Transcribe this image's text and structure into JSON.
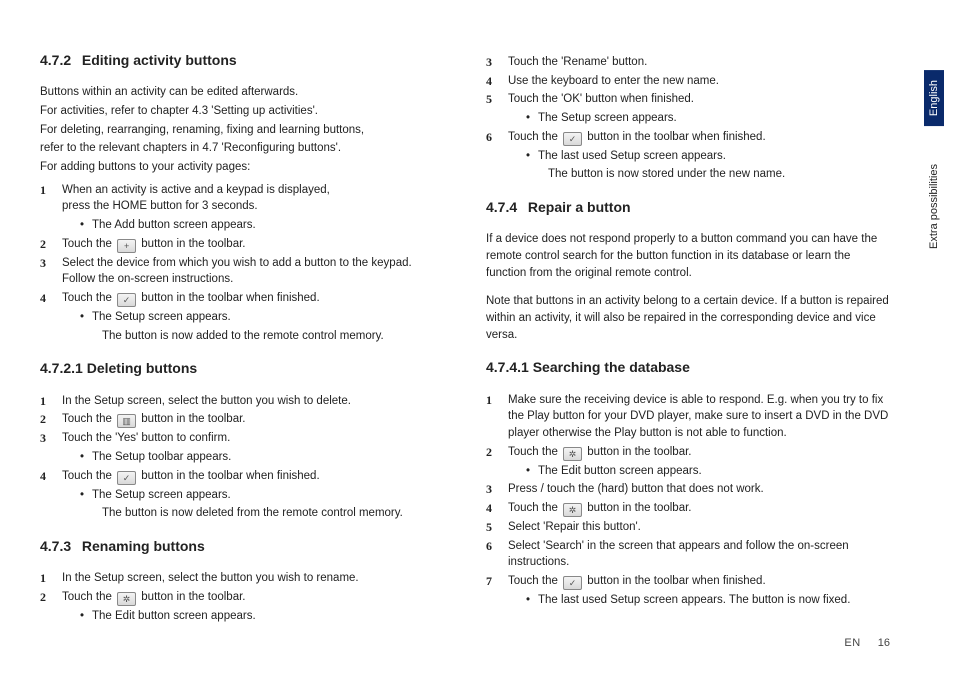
{
  "sideTabs": {
    "active": "English",
    "secondary": "Extra possibilities"
  },
  "footer": {
    "lang": "EN",
    "page": "16"
  },
  "left": {
    "s472": {
      "num": "4.7.2",
      "title": "Editing activity buttons",
      "intro": [
        "Buttons within an activity can be edited afterwards.",
        "For activities, refer to chapter 4.3 'Setting up activities'.",
        "For deleting, rearranging, renaming, fixing and learning buttons,",
        "refer to the relevant chapters in 4.7 'Reconfiguring buttons'.",
        "For adding buttons to your activity pages:"
      ],
      "steps": [
        {
          "n": "1",
          "t": "When an activity is active and a keypad is displayed,",
          "t2": "press the HOME button for 3 seconds.",
          "sub": [
            "The Add button screen appears."
          ]
        },
        {
          "n": "2",
          "pre": "Touch the ",
          "icon": "plus-icon",
          "iconGlyph": "+",
          "post": " button in the toolbar."
        },
        {
          "n": "3",
          "t": "Select the device from which you wish to add a button to the keypad.",
          "t2": "Follow the on-screen instructions."
        },
        {
          "n": "4",
          "pre": "Touch the ",
          "icon": "check-icon",
          "iconGlyph": "✓",
          "post": " button in the toolbar when finished.",
          "sub": [
            "The Setup screen appears."
          ],
          "cont": "The button is now added to the remote control memory."
        }
      ]
    },
    "s4721": {
      "num": "4.7.2.1",
      "title": "Deleting buttons",
      "steps": [
        {
          "n": "1",
          "t": "In the Setup screen, select the button you wish to delete."
        },
        {
          "n": "2",
          "pre": "Touch the ",
          "icon": "trash-icon",
          "iconGlyph": "▥",
          "post": " button in the toolbar."
        },
        {
          "n": "3",
          "t": "Touch the 'Yes' button to confirm.",
          "sub": [
            "The Setup toolbar appears."
          ]
        },
        {
          "n": "4",
          "pre": "Touch the ",
          "icon": "check-icon",
          "iconGlyph": "✓",
          "post": " button in the toolbar when finished.",
          "sub": [
            "The Setup screen appears."
          ],
          "cont": "The button is now deleted from the remote control memory."
        }
      ]
    },
    "s473": {
      "num": "4.7.3",
      "title": "Renaming buttons",
      "steps": [
        {
          "n": "1",
          "t": "In the Setup screen, select the button you wish to rename."
        },
        {
          "n": "2",
          "pre": "Touch the ",
          "icon": "gear-icon",
          "iconGlyph": "✲",
          "post": " button in the toolbar.",
          "sub": [
            "The Edit button screen appears."
          ]
        }
      ]
    }
  },
  "right": {
    "contSteps": [
      {
        "n": "3",
        "t": "Touch the 'Rename' button."
      },
      {
        "n": "4",
        "t": "Use the keyboard to enter the new name."
      },
      {
        "n": "5",
        "t": "Touch the 'OK' button when finished.",
        "sub": [
          "The Setup screen appears."
        ]
      },
      {
        "n": "6",
        "pre": "Touch the ",
        "icon": "check-icon",
        "iconGlyph": "✓",
        "post": " button in the toolbar when finished.",
        "sub": [
          "The last used Setup screen appears."
        ],
        "cont": "The button is now stored under the new name."
      }
    ],
    "s474": {
      "num": "4.7.4",
      "title": "Repair a button",
      "intro": [
        "If a device does not respond properly to a button command you can have the remote control search for the button function in its database or learn the function from the original remote control.",
        "Note that buttons in an activity belong to a certain device. If a button is repaired within an activity, it will also be repaired in the corresponding device and vice versa."
      ]
    },
    "s4741": {
      "num": "4.7.4.1",
      "title": "Searching the database",
      "steps": [
        {
          "n": "1",
          "t": "Make sure the receiving device is able to respond. E.g. when you try to fix the Play button for your DVD player, make sure to insert a DVD in the DVD player otherwise the Play button is not able to function."
        },
        {
          "n": "2",
          "pre": "Touch the ",
          "icon": "gear-icon",
          "iconGlyph": "✲",
          "post": "  button in the toolbar.",
          "sub": [
            "The Edit button screen appears."
          ]
        },
        {
          "n": "3",
          "t": "Press / touch the (hard) button that does not work."
        },
        {
          "n": "4",
          "pre": "Touch the ",
          "icon": "gear-icon",
          "iconGlyph": "✲",
          "post": " button in the toolbar."
        },
        {
          "n": "5",
          "t": "Select 'Repair this button'."
        },
        {
          "n": "6",
          "t": "Select 'Search' in the screen that appears and follow the on-screen instructions."
        },
        {
          "n": "7",
          "pre": "Touch the ",
          "icon": "check-icon",
          "iconGlyph": "✓",
          "post": " button in the toolbar when finished.",
          "sub": [
            "The last used Setup screen appears. The button is now fixed."
          ]
        }
      ]
    }
  }
}
